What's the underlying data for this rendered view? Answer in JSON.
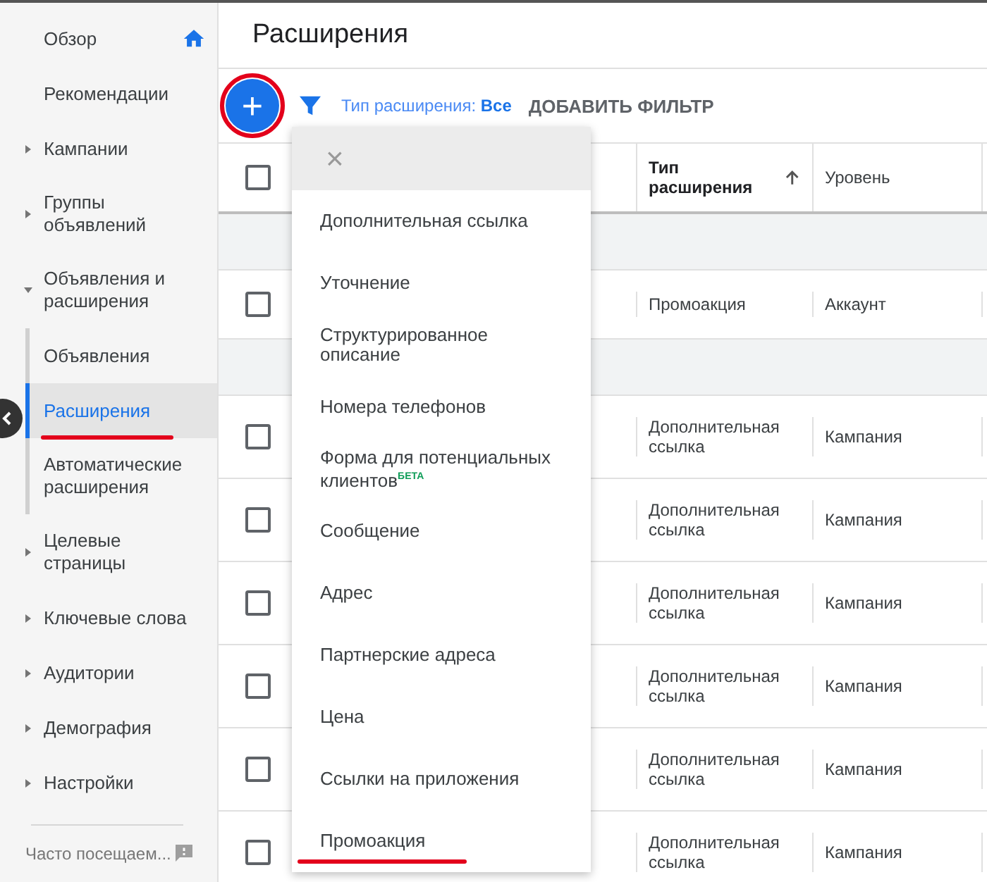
{
  "sidebar": {
    "items": [
      {
        "label": "Обзор",
        "kind": "home",
        "selected": false,
        "annotated": false
      },
      {
        "label": "Рекомендации",
        "kind": "plain",
        "selected": false,
        "annotated": false
      },
      {
        "label": "Кампании",
        "kind": "expandable",
        "expanded": false,
        "selected": false,
        "annotated": false
      },
      {
        "label": "Группы объявлений",
        "kind": "expandable",
        "expanded": false,
        "selected": false,
        "annotated": false
      },
      {
        "label": "Объявления и расширения",
        "kind": "expandable",
        "expanded": true,
        "selected": false,
        "annotated": false,
        "children": [
          {
            "label": "Объявления",
            "selected": false,
            "annotated": false
          },
          {
            "label": "Расширения",
            "selected": true,
            "annotated": true
          },
          {
            "label": "Автоматические расширения",
            "selected": false,
            "annotated": false
          }
        ]
      },
      {
        "label": "Целевые страницы",
        "kind": "expandable",
        "expanded": false,
        "selected": false,
        "annotated": false
      },
      {
        "label": "Ключевые слова",
        "kind": "expandable",
        "expanded": false,
        "selected": false,
        "annotated": false
      },
      {
        "label": "Аудитории",
        "kind": "expandable",
        "expanded": false,
        "selected": false,
        "annotated": false
      },
      {
        "label": "Демография",
        "kind": "expandable",
        "expanded": false,
        "selected": false,
        "annotated": false
      },
      {
        "label": "Настройки",
        "kind": "expandable",
        "expanded": false,
        "selected": false,
        "annotated": false
      }
    ],
    "footer": "Часто посещаем..."
  },
  "page_title": "Расширения",
  "toolbar": {
    "add_button": {
      "label": "+",
      "annotated": true
    },
    "filter_label": "Тип расширения:",
    "filter_value": "Все",
    "add_filter": "ДОБАВИТЬ ФИЛЬТР"
  },
  "table": {
    "select_all_checked": false,
    "columns": [
      {
        "label": "Тип расширения",
        "sorted": true
      },
      {
        "label": "Уровень",
        "sorted": false
      }
    ],
    "rows": [
      {
        "kind": "group"
      },
      {
        "kind": "data",
        "checked": false,
        "type": "Промоакция",
        "level": "Аккаунт"
      },
      {
        "kind": "group"
      },
      {
        "kind": "data",
        "checked": false,
        "type": "Дополнительная ссылка",
        "level": "Кампания"
      },
      {
        "kind": "data",
        "checked": false,
        "type": "Дополнительная ссылка",
        "level": "Кампания"
      },
      {
        "kind": "data",
        "checked": false,
        "type": "Дополнительная ссылка",
        "level": "Кампания"
      },
      {
        "kind": "data",
        "checked": false,
        "type": "Дополнительная ссылка",
        "level": "Кампания"
      },
      {
        "kind": "data",
        "checked": false,
        "type": "Дополнительная ссылка",
        "level": "Кампания"
      },
      {
        "kind": "data",
        "checked": false,
        "type": "Дополнительная ссылка",
        "level": "Кампания"
      }
    ]
  },
  "menu": {
    "close": "×",
    "items": [
      {
        "label": "Дополнительная ссылка",
        "annotated": false
      },
      {
        "label": "Уточнение",
        "annotated": false
      },
      {
        "label": "Структурированное описание",
        "annotated": false
      },
      {
        "label": "Номера телефонов",
        "annotated": false
      },
      {
        "label": "Форма для потенциальных клиентов",
        "badge": "БЕТА",
        "annotated": false
      },
      {
        "label": "Сообщение",
        "annotated": false
      },
      {
        "label": "Адрес",
        "annotated": false
      },
      {
        "label": "Партнерские адреса",
        "annotated": false
      },
      {
        "label": "Цена",
        "annotated": false
      },
      {
        "label": "Ссылки на приложения",
        "annotated": false
      },
      {
        "label": "Промоакция",
        "annotated": true
      }
    ]
  }
}
